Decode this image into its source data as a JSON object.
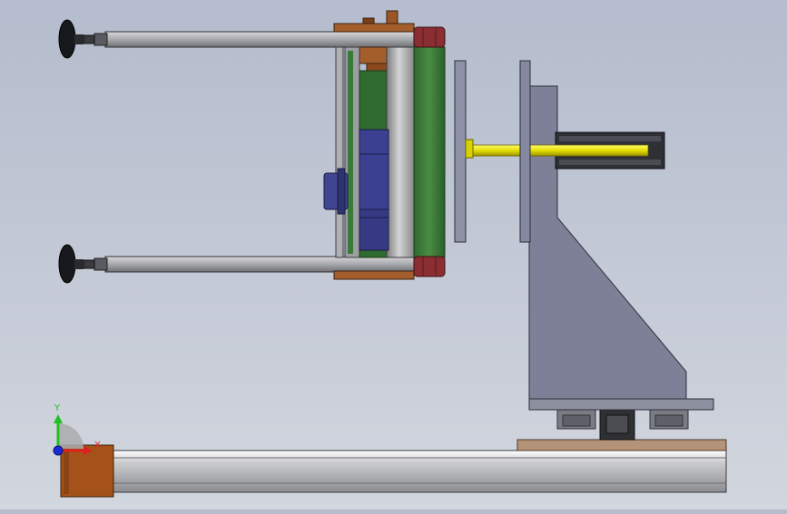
{
  "viewport": {
    "background_top": "#b4bccd",
    "background_bottom": "#d2d6de"
  },
  "triad": {
    "x_label": "X",
    "y_label": "Y",
    "x_color": "#e02020",
    "y_color": "#20c020",
    "z_color": "#1a2ad8"
  },
  "model_colors": {
    "steel": "#8f8f94",
    "frame_dark": "#6e7286",
    "green_panel": "#3c7a3a",
    "navy_motor": "#3a3f86",
    "brown_block": "#9a5a2a",
    "red_cap": "#8a2e32",
    "yellow_shaft": "#e8e400",
    "rail": "#b9bbbe"
  }
}
